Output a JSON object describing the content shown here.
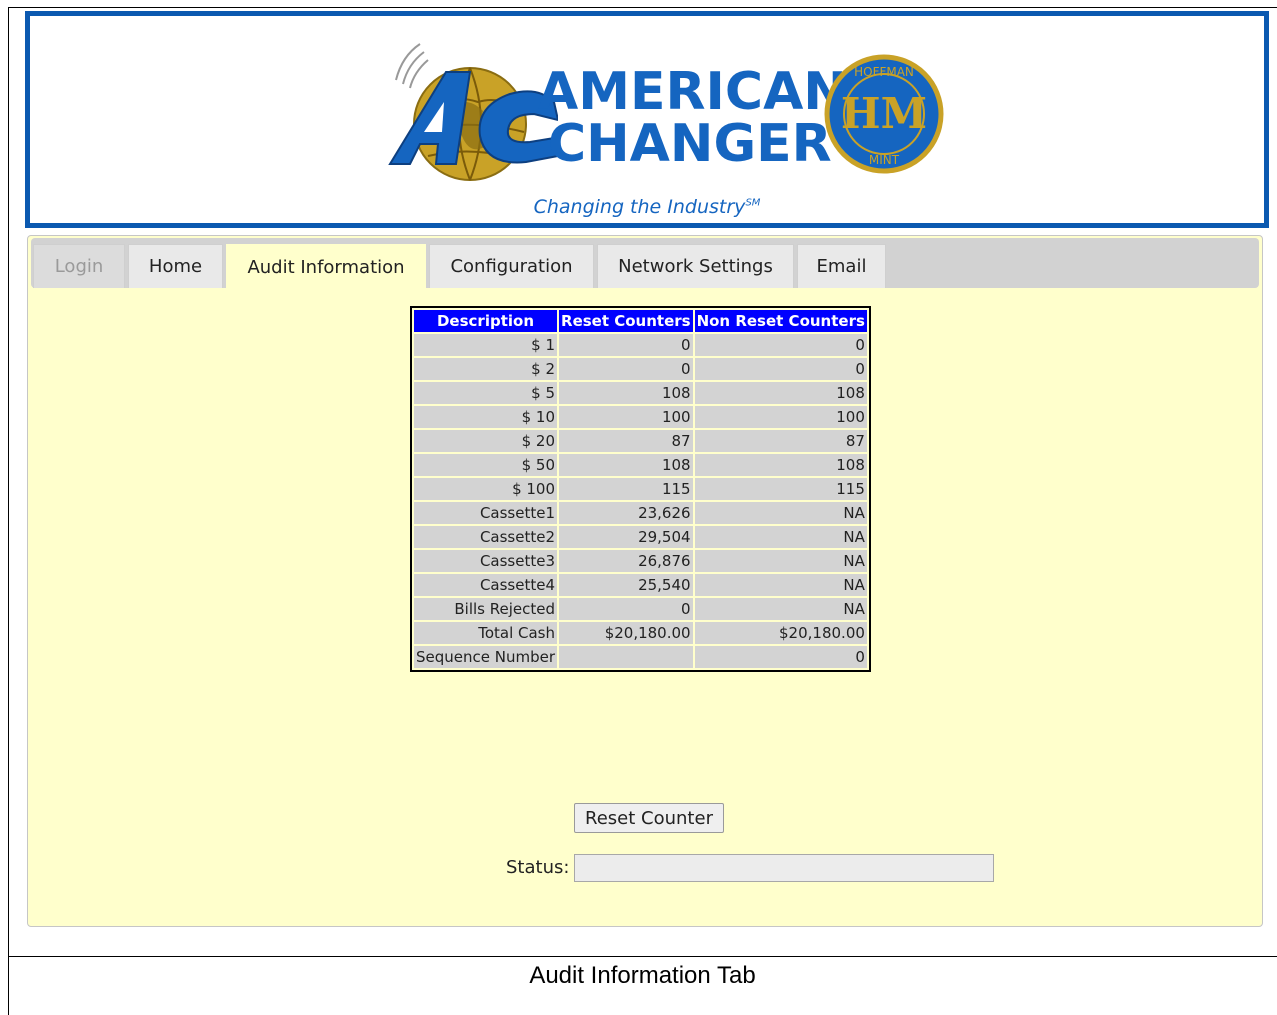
{
  "brand": {
    "name_line1": "AMERICAN",
    "name_line2": "CHANGER",
    "tagline": "Changing the Industry",
    "tagline_mark": "SM",
    "seal_letters_top": "HOFFMAN",
    "seal_letters_bottom": "MINT",
    "seal_monogram": "HM",
    "logo_monogram": "AC",
    "primary_color": "#1565c0",
    "gold_color": "#c9a227"
  },
  "tabs": [
    {
      "label": "Login",
      "state": "disabled"
    },
    {
      "label": "Home",
      "state": "normal"
    },
    {
      "label": "Audit Information",
      "state": "active"
    },
    {
      "label": "Configuration",
      "state": "normal"
    },
    {
      "label": "Network Settings",
      "state": "normal"
    },
    {
      "label": "Email",
      "state": "normal"
    }
  ],
  "table": {
    "headers": [
      "Description",
      "Reset Counters",
      "Non Reset Counters"
    ],
    "rows": [
      [
        "$ 1",
        "0",
        "0"
      ],
      [
        "$ 2",
        "0",
        "0"
      ],
      [
        "$ 5",
        "108",
        "108"
      ],
      [
        "$ 10",
        "100",
        "100"
      ],
      [
        "$ 20",
        "87",
        "87"
      ],
      [
        "$ 50",
        "108",
        "108"
      ],
      [
        "$ 100",
        "115",
        "115"
      ],
      [
        "Cassette1",
        "23,626",
        "NA"
      ],
      [
        "Cassette2",
        "29,504",
        "NA"
      ],
      [
        "Cassette3",
        "26,876",
        "NA"
      ],
      [
        "Cassette4",
        "25,540",
        "NA"
      ],
      [
        "Bills Rejected",
        "0",
        "NA"
      ],
      [
        "Total Cash",
        "$20,180.00",
        "$20,180.00"
      ],
      [
        "Sequence Number",
        "",
        "0"
      ]
    ]
  },
  "actions": {
    "reset_label": "Reset Counter",
    "status_label": "Status:",
    "status_value": ""
  },
  "caption": "Audit Information Tab"
}
